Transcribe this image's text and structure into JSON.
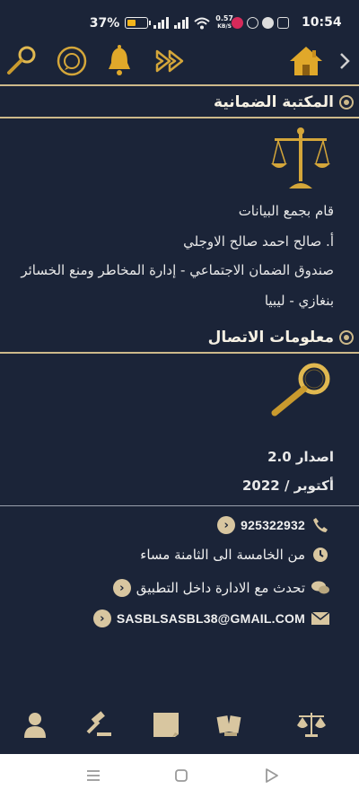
{
  "status_bar": {
    "battery": "37%",
    "net_speed_value": "0.57",
    "net_speed_unit": "KB/S",
    "time": "10:54"
  },
  "toolbar": {
    "icons": [
      "home-icon",
      "fast-forward-icon",
      "bell-icon",
      "whatsapp-icon",
      "magnifier-icon"
    ]
  },
  "library_section": {
    "title": "المكتبة الضمانية",
    "collected_by": "قام بجمع البيانات",
    "author": "أ. صالح احمد صالح  الاوجلي",
    "organization": "صندوق الضمان الاجتماعي - إدارة المخاطر ومنع الخسائر",
    "city": "بنغازي - ليبيا"
  },
  "contact_section": {
    "title": "معلومات الاتصال",
    "version": "اصدار 2.0",
    "date": "أكتوبر / 2022",
    "phone": "925322932",
    "hours": "من الخامسة الى الثامنة مساء",
    "chat": "تحدث مع الادارة داخل التطبيق",
    "email": "SASBLSASBL38@GMAIL.COM"
  },
  "colors": {
    "background": "#1b2438",
    "gold": "#d4a63a",
    "divider": "#cdb98a"
  }
}
